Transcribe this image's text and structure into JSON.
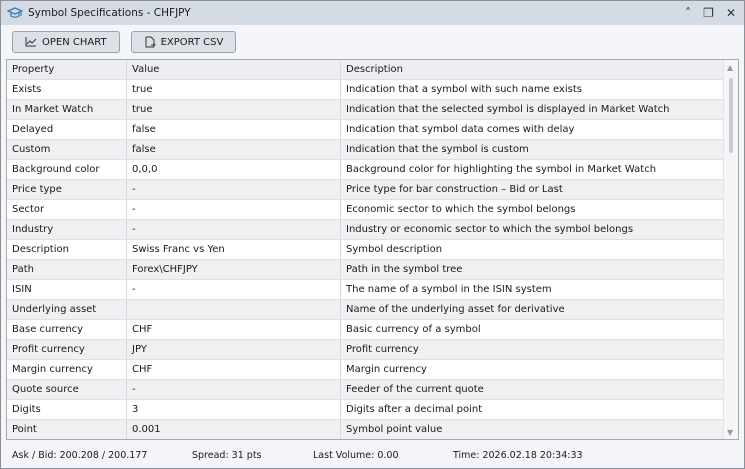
{
  "window": {
    "title": "Symbol Specifications - CHFJPY"
  },
  "toolbar": {
    "open_chart": "OPEN CHART",
    "export_csv": "EXPORT CSV"
  },
  "table": {
    "headers": [
      "Property",
      "Value",
      "Description"
    ],
    "rows": [
      [
        "Exists",
        "true",
        "Indication that a symbol with such name exists"
      ],
      [
        "In Market Watch",
        "true",
        "Indication that the selected symbol is displayed in Market Watch"
      ],
      [
        "Delayed",
        "false",
        "Indication that symbol data comes with delay"
      ],
      [
        "Custom",
        "false",
        "Indication that the symbol is custom"
      ],
      [
        "Background color",
        "0,0,0",
        "Background color for highlighting the symbol in Market Watch"
      ],
      [
        "Price type",
        "-",
        "Price type for bar construction – Bid or Last"
      ],
      [
        "Sector",
        "-",
        "Economic sector to which the symbol belongs"
      ],
      [
        "Industry",
        "-",
        "Industry or economic sector to which the symbol belongs"
      ],
      [
        "Description",
        "Swiss Franc vs Yen",
        "Symbol description"
      ],
      [
        "Path",
        "Forex\\CHFJPY",
        "Path in the symbol tree"
      ],
      [
        "ISIN",
        "-",
        "The name of a symbol in the ISIN system"
      ],
      [
        "Underlying asset",
        "",
        "Name of the underlying asset for derivative"
      ],
      [
        "Base currency",
        "CHF",
        "Basic currency of a symbol"
      ],
      [
        "Profit currency",
        "JPY",
        "Profit currency"
      ],
      [
        "Margin currency",
        "CHF",
        "Margin currency"
      ],
      [
        "Quote source",
        "-",
        "Feeder of the current quote"
      ],
      [
        "Digits",
        "3",
        "Digits after a decimal point"
      ],
      [
        "Point",
        "0.001",
        "Symbol point value"
      ]
    ]
  },
  "status": {
    "askbid": "Ask / Bid: 200.208 / 200.177",
    "spread": "Spread: 31 pts",
    "volume": "Last Volume: 0.00",
    "time": "Time: 2026.02.18 20:34:33"
  }
}
